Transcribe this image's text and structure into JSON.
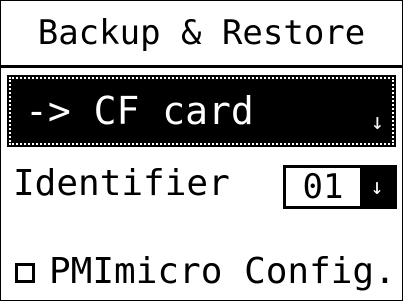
{
  "header": {
    "title": "Backup & Restore"
  },
  "target": {
    "selected": "-> CF card",
    "arrow_icon": "↓"
  },
  "identifier": {
    "label": "Identifier",
    "value": "01",
    "arrow_icon": "↓"
  },
  "option": {
    "checked": false,
    "label": "PMImicro Config."
  },
  "colors": {
    "foreground": "#000000",
    "background": "#ffffff"
  }
}
